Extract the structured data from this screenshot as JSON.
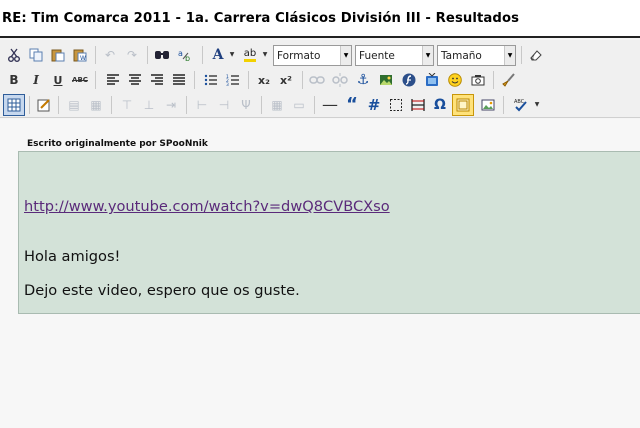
{
  "title": "RE: Tim Comarca 2011 - 1a. Carrera Clásicos División III - Resultados",
  "toolbar": {
    "format_select": "Formato",
    "font_select": "Fuente",
    "size_select": "Tamaño",
    "bold": "B",
    "italic": "I",
    "underline": "U",
    "strike": "ABC",
    "subscript": "x₂",
    "superscript": "x²",
    "quote": "“",
    "hash": "#",
    "omega": "Ω",
    "text_color_letter": "A",
    "highlight_letters": "ab",
    "spell_letters": "ABC"
  },
  "quote": {
    "caption": "Escrito originalmente por SPooNnik",
    "link": "http://www.youtube.com/watch?v=dwQ8CVBCXso",
    "line1": "Hola amigos!",
    "line2": "Dejo este video, espero que os guste."
  },
  "colors": {
    "quote_background": "#d3e2d8",
    "link": "#5a2a7a",
    "toolbar_background": "#f0f0f0"
  }
}
